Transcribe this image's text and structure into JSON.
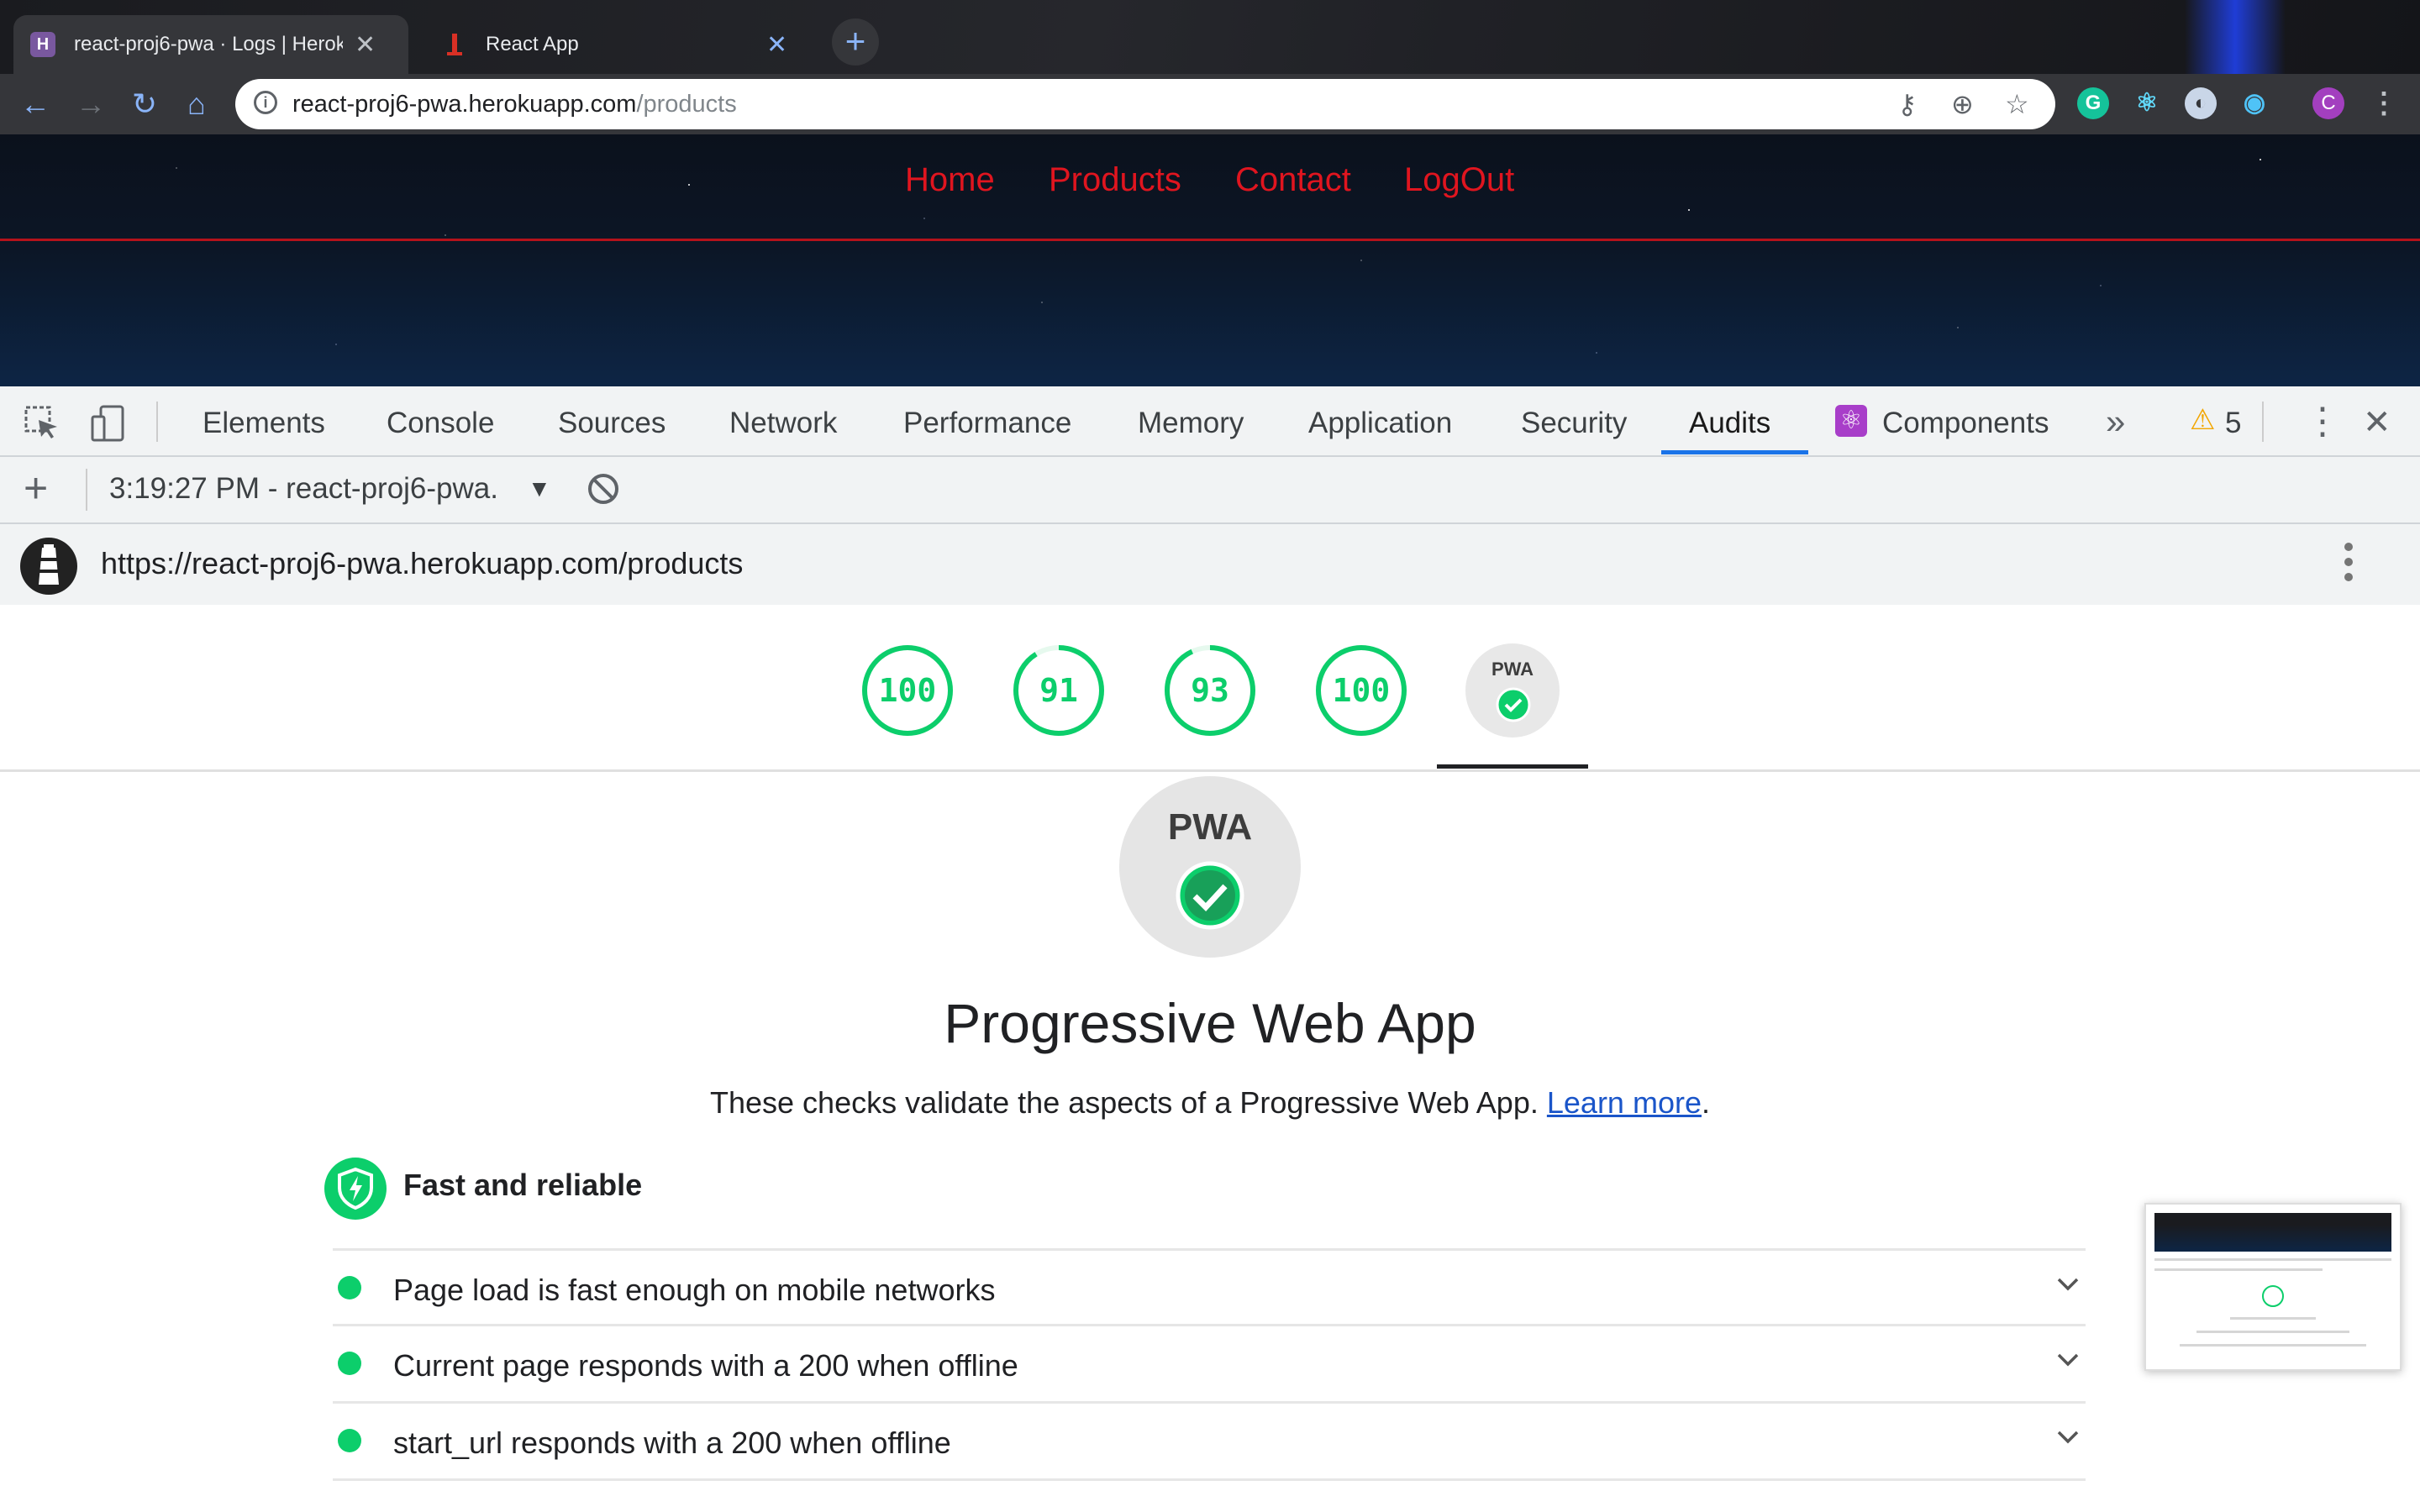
{
  "browser": {
    "tabs": [
      {
        "title": "react-proj6-pwa · Logs | Heroku",
        "favicon": "heroku-icon",
        "active": true
      },
      {
        "title": "React App",
        "favicon": "react-app-icon",
        "active": false
      }
    ],
    "address": {
      "host": "react-proj6-pwa.herokuapp.com",
      "path": "/products"
    },
    "profile_initial": "C"
  },
  "site_nav": {
    "items": [
      "Home",
      "Products",
      "Contact",
      "LogOut"
    ],
    "color": "#e0151f"
  },
  "devtools": {
    "tabs": [
      "Elements",
      "Console",
      "Sources",
      "Network",
      "Performance",
      "Memory",
      "Application",
      "Security",
      "Audits",
      "Components"
    ],
    "selected_tab": "Audits",
    "warning_count": "5"
  },
  "audits": {
    "run_label": "3:19:27 PM - react-proj6-pwa.",
    "report_url": "https://react-proj6-pwa.herokuapp.com/products",
    "scores": [
      "100",
      "91",
      "93",
      "100"
    ],
    "pwa_badge": "PWA",
    "category": {
      "title": "Progressive Web App",
      "description": "These checks validate the aspects of a Progressive Web App.",
      "learn_more": "Learn more",
      "group_title": "Fast and reliable",
      "audits": [
        "Page load is fast enough on mobile networks",
        "Current page responds with a 200 when offline",
        "start_url responds with a 200 when offline"
      ]
    },
    "pass_color": "#0cce6b"
  }
}
